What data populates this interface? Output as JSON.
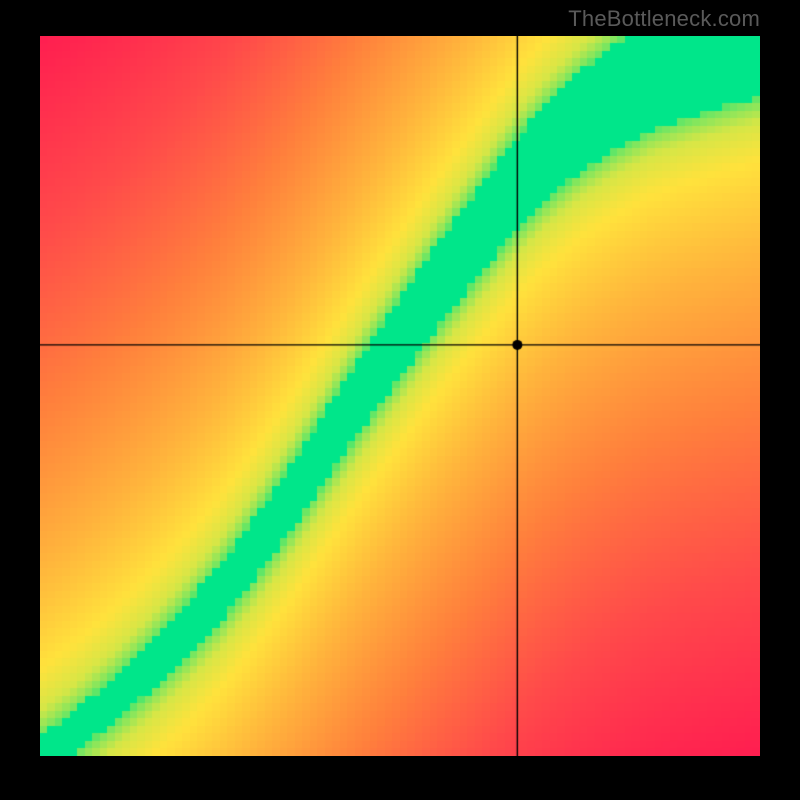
{
  "watermark": "TheBottleneck.com",
  "chart_data": {
    "type": "heatmap",
    "title": "",
    "xlabel": "",
    "ylabel": "",
    "xlim": [
      0,
      1
    ],
    "ylim": [
      0,
      1
    ],
    "marker": {
      "x": 0.663,
      "y": 0.571
    },
    "crosshair": {
      "x": 0.663,
      "y": 0.571
    },
    "ideal_curve": [
      [
        0.0,
        0.0
      ],
      [
        0.05,
        0.035
      ],
      [
        0.1,
        0.075
      ],
      [
        0.15,
        0.12
      ],
      [
        0.2,
        0.17
      ],
      [
        0.25,
        0.225
      ],
      [
        0.3,
        0.29
      ],
      [
        0.35,
        0.36
      ],
      [
        0.4,
        0.435
      ],
      [
        0.45,
        0.51
      ],
      [
        0.5,
        0.58
      ],
      [
        0.55,
        0.65
      ],
      [
        0.6,
        0.715
      ],
      [
        0.65,
        0.78
      ],
      [
        0.7,
        0.835
      ],
      [
        0.75,
        0.88
      ],
      [
        0.8,
        0.915
      ],
      [
        0.85,
        0.945
      ],
      [
        0.9,
        0.965
      ],
      [
        0.95,
        0.983
      ],
      [
        1.0,
        1.0
      ]
    ],
    "band_halfwidth_start": 0.025,
    "band_halfwidth_end": 0.085,
    "color_stops": [
      {
        "t": 0.0,
        "color": "#00e68a"
      },
      {
        "t": 0.08,
        "color": "#55e66a"
      },
      {
        "t": 0.16,
        "color": "#d6e646"
      },
      {
        "t": 0.24,
        "color": "#ffe23c"
      },
      {
        "t": 0.4,
        "color": "#ffb43c"
      },
      {
        "t": 0.6,
        "color": "#ff803c"
      },
      {
        "t": 0.8,
        "color": "#ff4a4a"
      },
      {
        "t": 1.0,
        "color": "#ff1e50"
      }
    ],
    "pixelation": 96
  }
}
